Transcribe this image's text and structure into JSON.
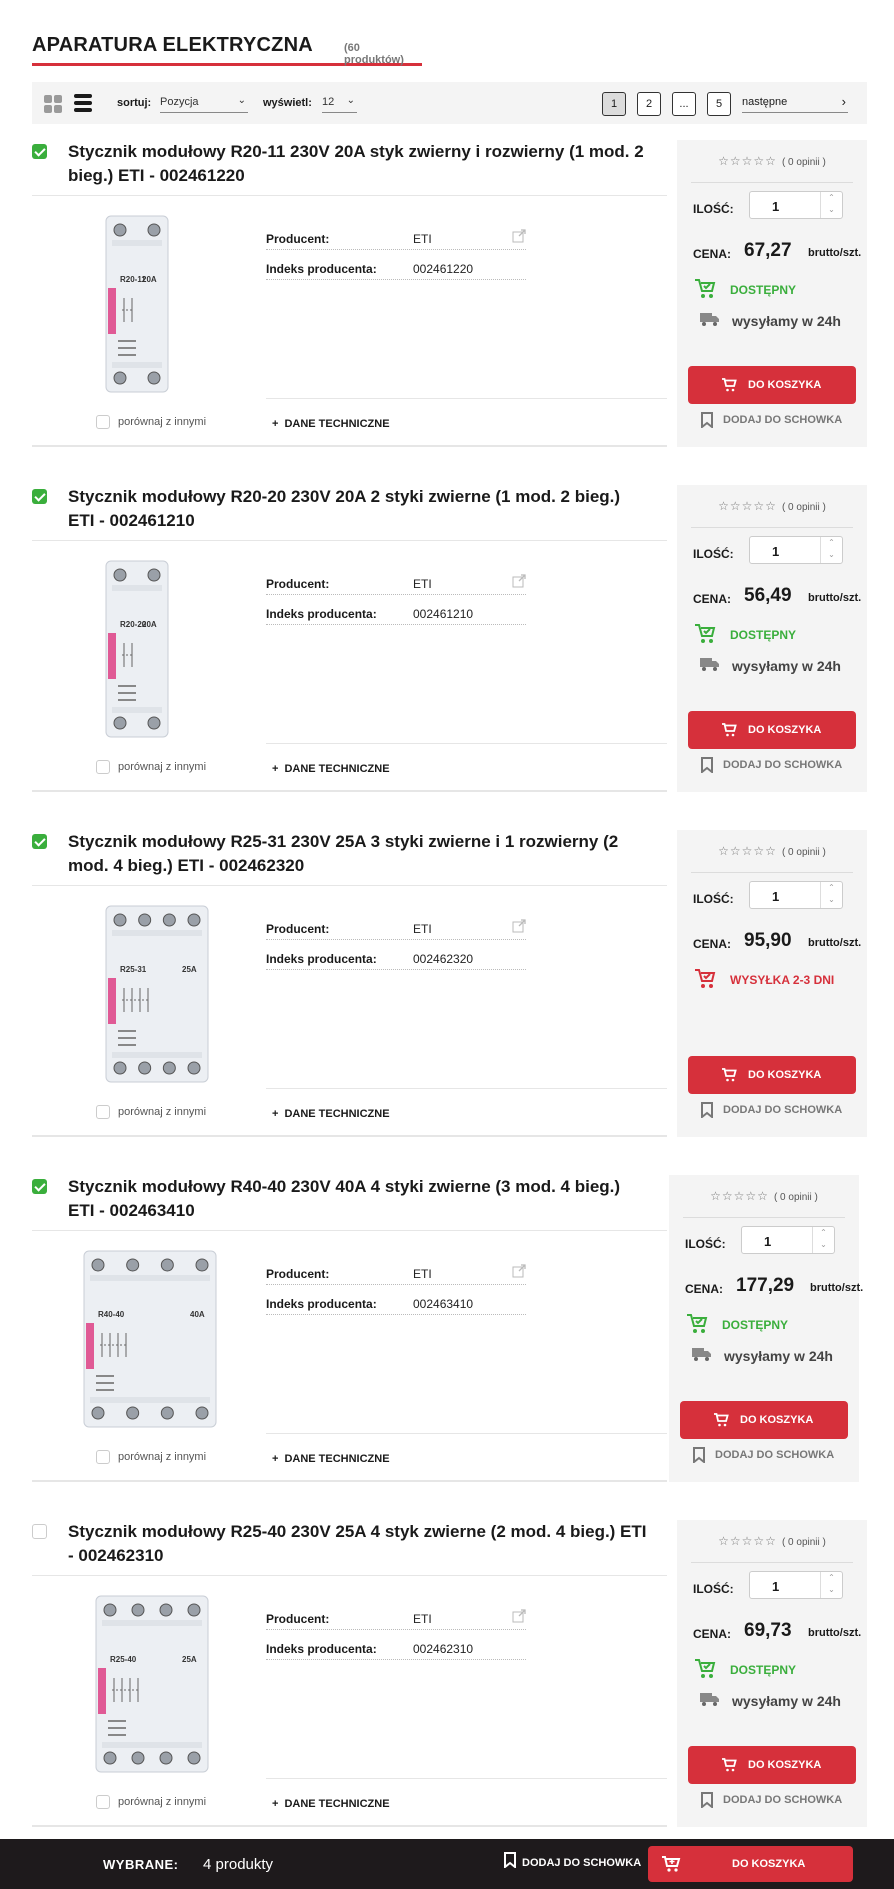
{
  "category": {
    "title": "APARATURA ELEKTRYCZNA",
    "count": "(60 produktów)"
  },
  "toolbar": {
    "sort_label": "sortuj:",
    "sort_value": "Pozycja",
    "show_label": "wyświetl:",
    "show_value": "12",
    "pages": [
      "1",
      "2",
      "...",
      "5"
    ],
    "next_label": "następne"
  },
  "labels": {
    "producer": "Producent:",
    "index": "Indeks producenta:",
    "compare": "porównaj z innymi",
    "tech": "DANE TECHNICZNE",
    "qty": "ILOŚĆ:",
    "price": "CENA:",
    "unit": "brutto/szt.",
    "add_to_cart": "DO KOSZYKA",
    "add_to_clipboard": "DODAJ DO SCHOWKA",
    "stars": "☆☆☆☆☆",
    "opinions": "( 0 opinii )"
  },
  "products": [
    {
      "checked": true,
      "title": "Stycznik modułowy R20-11 230V 20A styk zwierny i rozwierny (1 mod. 2 bieg.) ETI - 002461220",
      "producer": "ETI",
      "index": "002461220",
      "qty": "1",
      "price": "67,27",
      "availability": "DOSTĘPNY",
      "availability_status": "available",
      "shipping": "wysyłamy w 24h",
      "image_model": "R20-11",
      "image_rating": "20A",
      "image_modules": 1
    },
    {
      "checked": true,
      "title": "Stycznik modułowy R20-20 230V 20A 2 styki zwierne (1 mod. 2 bieg.) ETI - 002461210",
      "producer": "ETI",
      "index": "002461210",
      "qty": "1",
      "price": "56,49",
      "availability": "DOSTĘPNY",
      "availability_status": "available",
      "shipping": "wysyłamy w 24h",
      "image_model": "R20-20",
      "image_rating": "20A",
      "image_modules": 1
    },
    {
      "checked": true,
      "title": "Stycznik modułowy R25-31 230V 25A 3 styki zwierne i 1 rozwierny (2 mod. 4 bieg.) ETI - 002462320",
      "producer": "ETI",
      "index": "002462320",
      "qty": "1",
      "price": "95,90",
      "availability": "WYSYŁKA 2-3 DNI",
      "availability_status": "delayed",
      "shipping": "",
      "image_model": "R25-31",
      "image_rating": "25A",
      "image_modules": 2
    },
    {
      "checked": true,
      "title": "Stycznik modułowy R40-40 230V 40A 4 styki zwierne (3 mod. 4 bieg.) ETI - 002463410",
      "producer": "ETI",
      "index": "002463410",
      "qty": "1",
      "price": "177,29",
      "availability": "DOSTĘPNY",
      "availability_status": "available",
      "shipping": "wysyłamy w 24h",
      "image_model": "R40-40",
      "image_rating": "40A",
      "image_modules": 3
    },
    {
      "checked": false,
      "title": "Stycznik modułowy R25-40 230V 25A 4 styk zwierne (2 mod. 4 bieg.) ETI - 002462310",
      "producer": "ETI",
      "index": "002462310",
      "qty": "1",
      "price": "69,73",
      "availability": "DOSTĘPNY",
      "availability_status": "available",
      "shipping": "wysyłamy w 24h",
      "image_model": "R25-40",
      "image_rating": "25A",
      "image_modules": 2
    }
  ],
  "bottom_bar": {
    "selected_label": "WYBRANE:",
    "selected_count": "4 produkty",
    "clipboard_label": "DODAJ DO SCHOWKA",
    "cart_label": "DO KOSZYKA"
  },
  "colors": {
    "accent": "#d6303b",
    "available": "#3aae3c",
    "checkbox": "#3aae3c",
    "bar": "#1e1a1c"
  }
}
